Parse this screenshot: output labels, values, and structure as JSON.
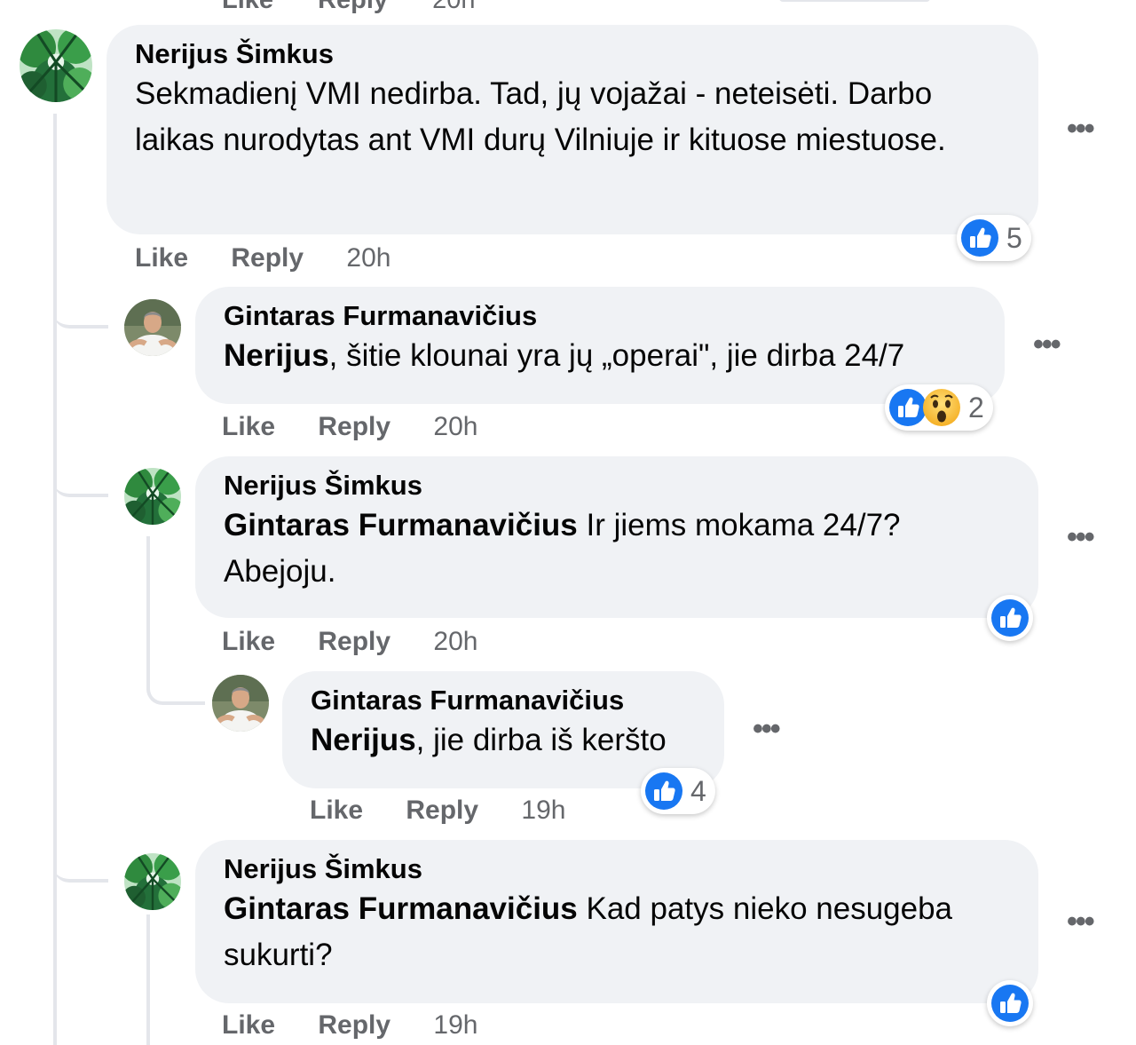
{
  "top_partial": {
    "like": "Like",
    "reply": "Reply",
    "time": "20h"
  },
  "colors": {
    "bubble": "#f0f2f5",
    "like_blue": "#1877f2",
    "meta_gray": "#65676b",
    "thread_line": "#e4e6eb"
  },
  "comments": [
    {
      "author": "Nerijus Šimkus",
      "text": "Sekmadienį VMI nedirba. Tad, jų vojažai - neteisėti. Darbo laikas nurodytas ant VMI durų Vilniuje ir kituose miestuose.",
      "like_label": "Like",
      "reply_label": "Reply",
      "time": "20h",
      "reactions": {
        "icons": [
          "like-icon"
        ],
        "count": "5"
      },
      "more_icon": "more-options-icon"
    },
    {
      "author": "Gintaras Furmanavičius",
      "mention": "Nerijus",
      "text": ", šitie klounai yra jų „operai\", jie dirba 24/7",
      "like_label": "Like",
      "reply_label": "Reply",
      "time": "20h",
      "reactions": {
        "icons": [
          "like-icon",
          "wow-icon"
        ],
        "count": "2"
      }
    },
    {
      "author": "Nerijus Šimkus",
      "mention": "Gintaras Furmanavičius",
      "text": " Ir jiems mokama 24/7? Abejoju.",
      "like_label": "Like",
      "reply_label": "Reply",
      "time": "20h",
      "reactions": {
        "icons": [
          "like-icon"
        ],
        "count": ""
      }
    },
    {
      "author": "Gintaras Furmanavičius",
      "mention": "Nerijus",
      "text": ", jie dirba iš keršto",
      "like_label": "Like",
      "reply_label": "Reply",
      "time": "19h",
      "reactions": {
        "icons": [
          "like-icon"
        ],
        "count": "4"
      }
    },
    {
      "author": "Nerijus Šimkus",
      "mention": "Gintaras Furmanavičius",
      "text": " Kad patys nieko nesugeba sukurti?",
      "like_label": "Like",
      "reply_label": "Reply",
      "time": "19h",
      "reactions": {
        "icons": [
          "like-icon"
        ],
        "count": ""
      }
    }
  ]
}
